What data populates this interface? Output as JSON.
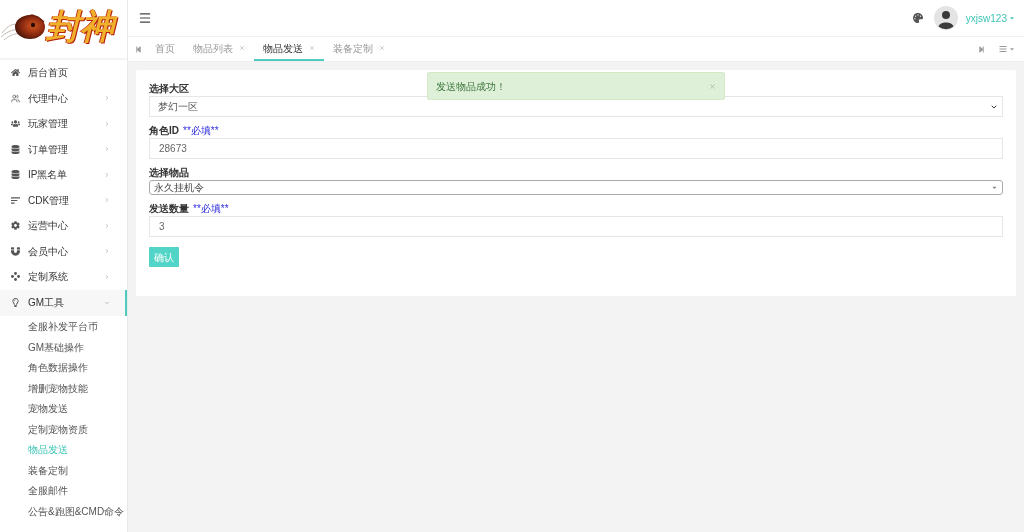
{
  "sidebar": {
    "logo_text": "封神",
    "menu": [
      {
        "label": "后台首页",
        "kind": "link",
        "selected": false
      },
      {
        "label": "代理中心",
        "kind": "group",
        "expanded": false,
        "selected": false
      },
      {
        "label": "玩家管理",
        "kind": "group",
        "expanded": false,
        "selected": false
      },
      {
        "label": "订单管理",
        "kind": "group",
        "expanded": false,
        "selected": false
      },
      {
        "label": "IP黑名单",
        "kind": "group",
        "expanded": false,
        "selected": false
      },
      {
        "label": "CDK管理",
        "kind": "group",
        "expanded": false,
        "selected": false
      },
      {
        "label": "运营中心",
        "kind": "group",
        "expanded": false,
        "selected": false
      },
      {
        "label": "会员中心",
        "kind": "group",
        "expanded": false,
        "selected": false
      },
      {
        "label": "定制系统",
        "kind": "group",
        "expanded": false,
        "selected": false
      },
      {
        "label": "GM工具",
        "kind": "group",
        "expanded": true,
        "selected": true,
        "children": [
          {
            "label": "全服补发平台币",
            "selected": false
          },
          {
            "label": "GM基础操作",
            "selected": false
          },
          {
            "label": "角色数据操作",
            "selected": false
          },
          {
            "label": "增删宠物技能",
            "selected": false
          },
          {
            "label": "宠物发送",
            "selected": false
          },
          {
            "label": "定制宠物资质",
            "selected": false
          },
          {
            "label": "物品发送",
            "selected": true
          },
          {
            "label": "装备定制",
            "selected": false
          },
          {
            "label": "全服邮件",
            "selected": false
          },
          {
            "label": "公告&跑图&CMD命令",
            "selected": false
          }
        ]
      }
    ]
  },
  "header": {
    "user": {
      "name": "yxjsw123"
    }
  },
  "tabs": [
    {
      "label": "首页",
      "closable": false,
      "selected": false
    },
    {
      "label": "物品列表",
      "closable": true,
      "selected": false
    },
    {
      "label": "物品发送",
      "closable": true,
      "selected": true
    },
    {
      "label": "装备定制",
      "closable": true,
      "selected": false
    }
  ],
  "form": {
    "fields": [
      {
        "kind": "select",
        "label": "选择大区",
        "value": "梦幻一区"
      },
      {
        "kind": "input",
        "label": "角色ID",
        "note": "**必填**",
        "value": "28673"
      },
      {
        "kind": "combo",
        "label": "选择物品",
        "value": "永久挂机令"
      },
      {
        "kind": "input",
        "label": "发送数量",
        "note": "**必填**",
        "value": "3"
      }
    ],
    "submit": "确认"
  },
  "toast": {
    "message": "发送物品成功！"
  }
}
